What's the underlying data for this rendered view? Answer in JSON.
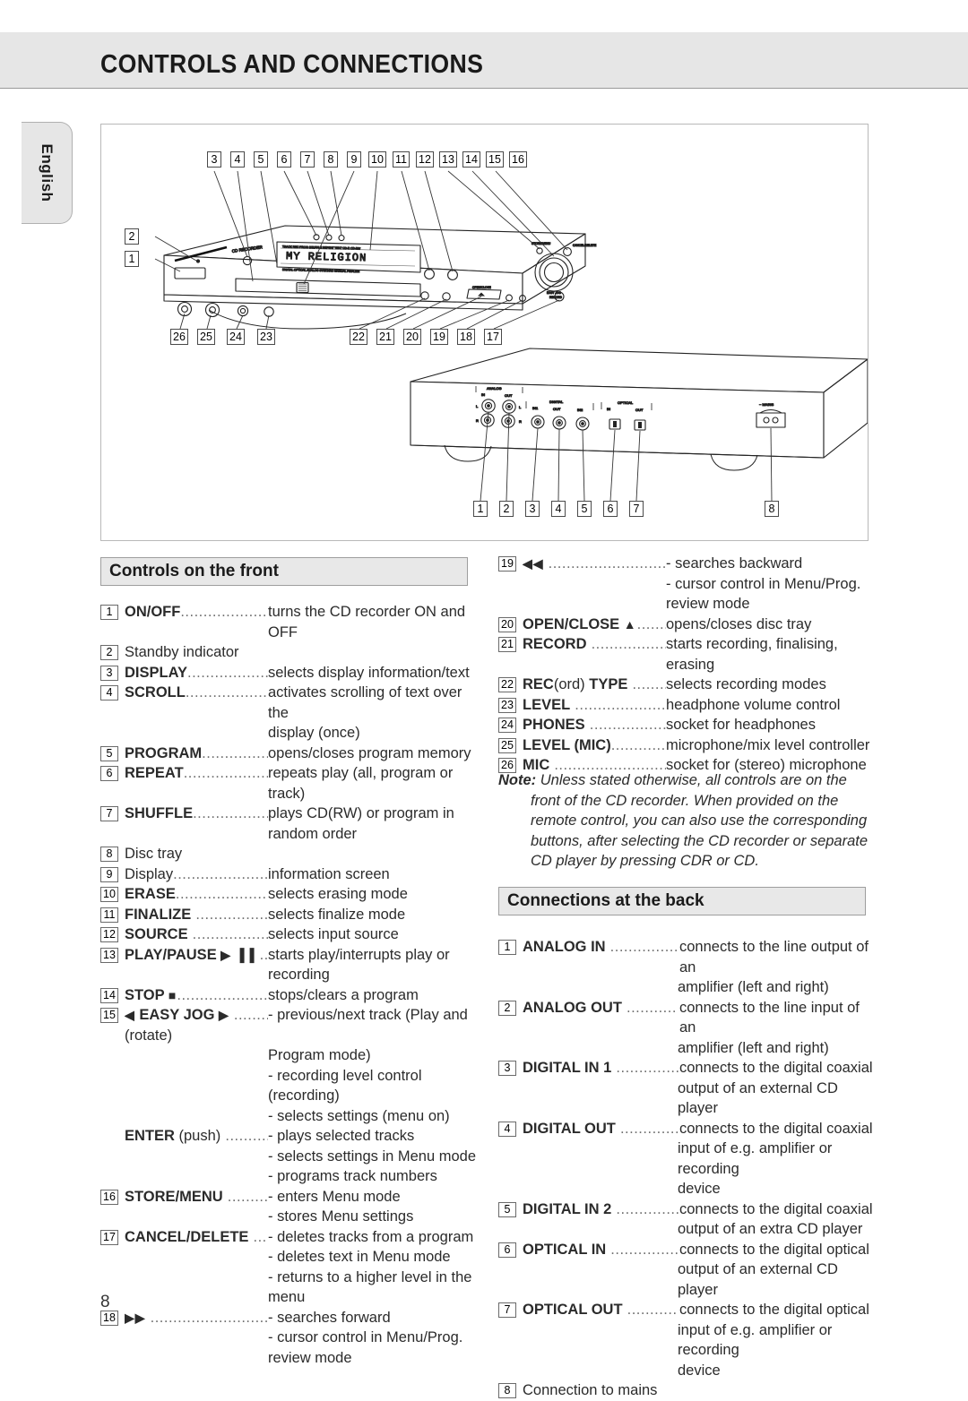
{
  "page_title": "CONTROLS AND CONNECTIONS",
  "language_tab": "English",
  "page_number": "8",
  "diagram": {
    "front_callouts_top": [
      "3",
      "4",
      "5",
      "6",
      "7",
      "8",
      "9",
      "10",
      "11",
      "12",
      "13",
      "14",
      "15",
      "16"
    ],
    "front_callouts_left": [
      "2",
      "1"
    ],
    "front_callouts_bottom_left": [
      "26",
      "25",
      "24",
      "23"
    ],
    "front_callouts_bottom_right": [
      "22",
      "21",
      "20",
      "19",
      "18",
      "17"
    ],
    "rear_callouts": [
      "1",
      "2",
      "3",
      "4",
      "5",
      "6",
      "7"
    ],
    "rear_callout_mains": "8",
    "display_text": "MY RELIGION",
    "rear_panel_labels": {
      "analog": "ANALOG",
      "analog_in": "IN",
      "analog_out": "OUT",
      "ch_left": "L",
      "ch_right": "R",
      "digital": "DIGITAL",
      "digital_in1": "IN1",
      "digital_out": "OUT",
      "digital_in2": "IN2",
      "optical": "OPTICAL",
      "optical_in": "IN",
      "optical_out": "OUT",
      "mains": "~ MAINS"
    }
  },
  "front_section": {
    "heading": "Controls on the front",
    "items": [
      {
        "num": "1",
        "label": "ON/OFF",
        "bold": true,
        "dots": "........................",
        "desc": "turns the CD recorder ON and OFF",
        "cont": []
      },
      {
        "num": "2",
        "label": "Standby indicator",
        "bold": false,
        "dots": "",
        "desc": "",
        "cont": []
      },
      {
        "num": "3",
        "label": "DISPLAY",
        "bold": true,
        "dots": "......................",
        "desc": "selects display information/text",
        "cont": []
      },
      {
        "num": "4",
        "label": "SCROLL",
        "bold": true,
        "dots": ".........................",
        "desc": "activates scrolling of text over the",
        "cont": [
          "display (once)"
        ]
      },
      {
        "num": "5",
        "label": "PROGRAM",
        "bold": true,
        "dots": "..................",
        "desc": "opens/closes program memory",
        "cont": []
      },
      {
        "num": "6",
        "label": "REPEAT",
        "bold": true,
        "dots": ".......................",
        "desc": "repeats play (all, program or track)",
        "cont": []
      },
      {
        "num": "7",
        "label": "SHUFFLE",
        "bold": true,
        "dots": ".....................",
        "desc": "plays CD(RW) or program in",
        "cont": [
          "random order"
        ]
      },
      {
        "num": "8",
        "label": "Disc tray",
        "bold": false,
        "dots": "",
        "desc": "",
        "cont": []
      },
      {
        "num": "9",
        "label": "Display",
        "bold": false,
        "dots": "..........................",
        "desc": "information screen",
        "cont": []
      },
      {
        "num": "10",
        "label": "ERASE",
        "bold": true,
        "dots": "........................",
        "desc": "selects erasing mode",
        "cont": []
      },
      {
        "num": "11",
        "label": "FINALIZE",
        "bold": true,
        "dots": " ....................",
        "desc": "selects finalize mode",
        "cont": []
      },
      {
        "num": "12",
        "label": "SOURCE",
        "bold": true,
        "dots": " .....................",
        "desc": "selects input source",
        "cont": []
      },
      {
        "num": "13",
        "label": "PLAY/PAUSE ▶ ▐▐",
        "bold": true,
        "dots": " ......",
        "desc": "starts play/interrupts play or",
        "cont": [
          "recording"
        ]
      },
      {
        "num": "14",
        "label": "STOP ■",
        "bold": true,
        "dots": ".......................",
        "desc": "stops/clears a program",
        "cont": []
      },
      {
        "num": "15",
        "label": "◀ EASY JOG ▶",
        "bold": true,
        "dots": " ........",
        "desc": "- previous/next track (Play and",
        "cont": [
          "Program mode)",
          "- recording level control (recording)",
          "- selects settings (menu on)"
        ],
        "sublabel": "(rotate)"
      },
      {
        "num": "",
        "label": "ENTER (push)",
        "bold": true,
        "dots": " ..............",
        "desc": "- plays selected tracks",
        "cont": [
          "- selects settings in Menu mode",
          "- programs track numbers"
        ],
        "reg_tail": " (push)"
      },
      {
        "num": "16",
        "label": "STORE/MENU",
        "bold": true,
        "dots": " ...........",
        "desc": "- enters Menu mode",
        "cont": [
          "- stores Menu settings"
        ]
      },
      {
        "num": "17",
        "label": "CANCEL/DELETE",
        "bold": true,
        "dots": " ......",
        "desc": "- deletes tracks from a program",
        "cont": [
          "- deletes text in Menu mode",
          "- returns to a higher level in the",
          "menu"
        ]
      },
      {
        "num": "18",
        "label": "▶▶",
        "bold": true,
        "dots": " ...........................",
        "desc": "- searches forward",
        "cont": [
          "- cursor control in Menu/Prog.",
          "review mode"
        ]
      }
    ]
  },
  "right_items_front": [
    {
      "num": "19",
      "label": "◀◀",
      "bold": true,
      "dots": " ...........................",
      "desc": "- searches backward",
      "cont": [
        "- cursor control in Menu/Prog.",
        "review mode"
      ]
    },
    {
      "num": "20",
      "label": "OPEN/CLOSE ▲",
      "bold": true,
      "dots": "..........",
      "desc": "opens/closes disc tray",
      "cont": []
    },
    {
      "num": "21",
      "label": "RECORD",
      "bold": true,
      "dots": " .....................",
      "desc": "starts recording, finalising, erasing",
      "cont": []
    },
    {
      "num": "22",
      "label": "REC(ord) TYPE",
      "bold": true,
      "dots": " ............",
      "desc": "selects recording modes",
      "cont": []
    },
    {
      "num": "23",
      "label": "LEVEL",
      "bold": true,
      "dots": " ..........................",
      "desc": "headphone volume control",
      "cont": []
    },
    {
      "num": "24",
      "label": "PHONES",
      "bold": true,
      "dots": " ....................",
      "desc": "socket for headphones",
      "cont": []
    },
    {
      "num": "25",
      "label": "LEVEL (MIC)",
      "bold": true,
      "dots": "...............",
      "desc": "microphone/mix level controller",
      "cont": []
    },
    {
      "num": "26",
      "label": "MIC",
      "bold": true,
      "dots": " ............................",
      "desc": "socket for (stereo) microphone",
      "cont": []
    }
  ],
  "note": {
    "prefix": "Note:",
    "body": "Unless stated otherwise, all controls are on the front of the CD recorder. When provided on the remote control, you can also use the corresponding buttons, after selecting the CD recorder or separate CD player by pressing CDR or CD."
  },
  "back_section": {
    "heading": "Connections at the back",
    "items": [
      {
        "num": "1",
        "label": "ANALOG IN",
        "bold": true,
        "dots": " ...............",
        "desc": "connects to the line output of an",
        "cont": [
          "amplifier (left and right)"
        ]
      },
      {
        "num": "2",
        "label": "ANALOG OUT",
        "bold": true,
        "dots": " ...........",
        "desc": "connects to the line input of an",
        "cont": [
          "amplifier (left and right)"
        ]
      },
      {
        "num": "3",
        "label": "DIGITAL IN 1",
        "bold": true,
        "dots": " ..............",
        "desc": "connects to the digital coaxial",
        "cont": [
          "output of an external CD player"
        ]
      },
      {
        "num": "4",
        "label": "DIGITAL OUT",
        "bold": true,
        "dots": " .............",
        "desc": "connects to the digital coaxial",
        "cont": [
          "input of e.g. amplifier or recording",
          "device"
        ]
      },
      {
        "num": "5",
        "label": "DIGITAL IN 2",
        "bold": true,
        "dots": " ..............",
        "desc": "connects to the digital coaxial",
        "cont": [
          "output of an extra CD player"
        ]
      },
      {
        "num": "6",
        "label": "OPTICAL IN",
        "bold": true,
        "dots": " ...............",
        "desc": "connects to the digital optical",
        "cont": [
          "output of an external CD player"
        ]
      },
      {
        "num": "7",
        "label": "OPTICAL OUT",
        "bold": true,
        "dots": " ...........",
        "desc": "connects to the digital optical",
        "cont": [
          "input of e.g. amplifier or recording",
          "device"
        ]
      },
      {
        "num": "8",
        "label": "Connection to mains",
        "bold": false,
        "dots": "",
        "desc": "",
        "cont": []
      }
    ]
  }
}
